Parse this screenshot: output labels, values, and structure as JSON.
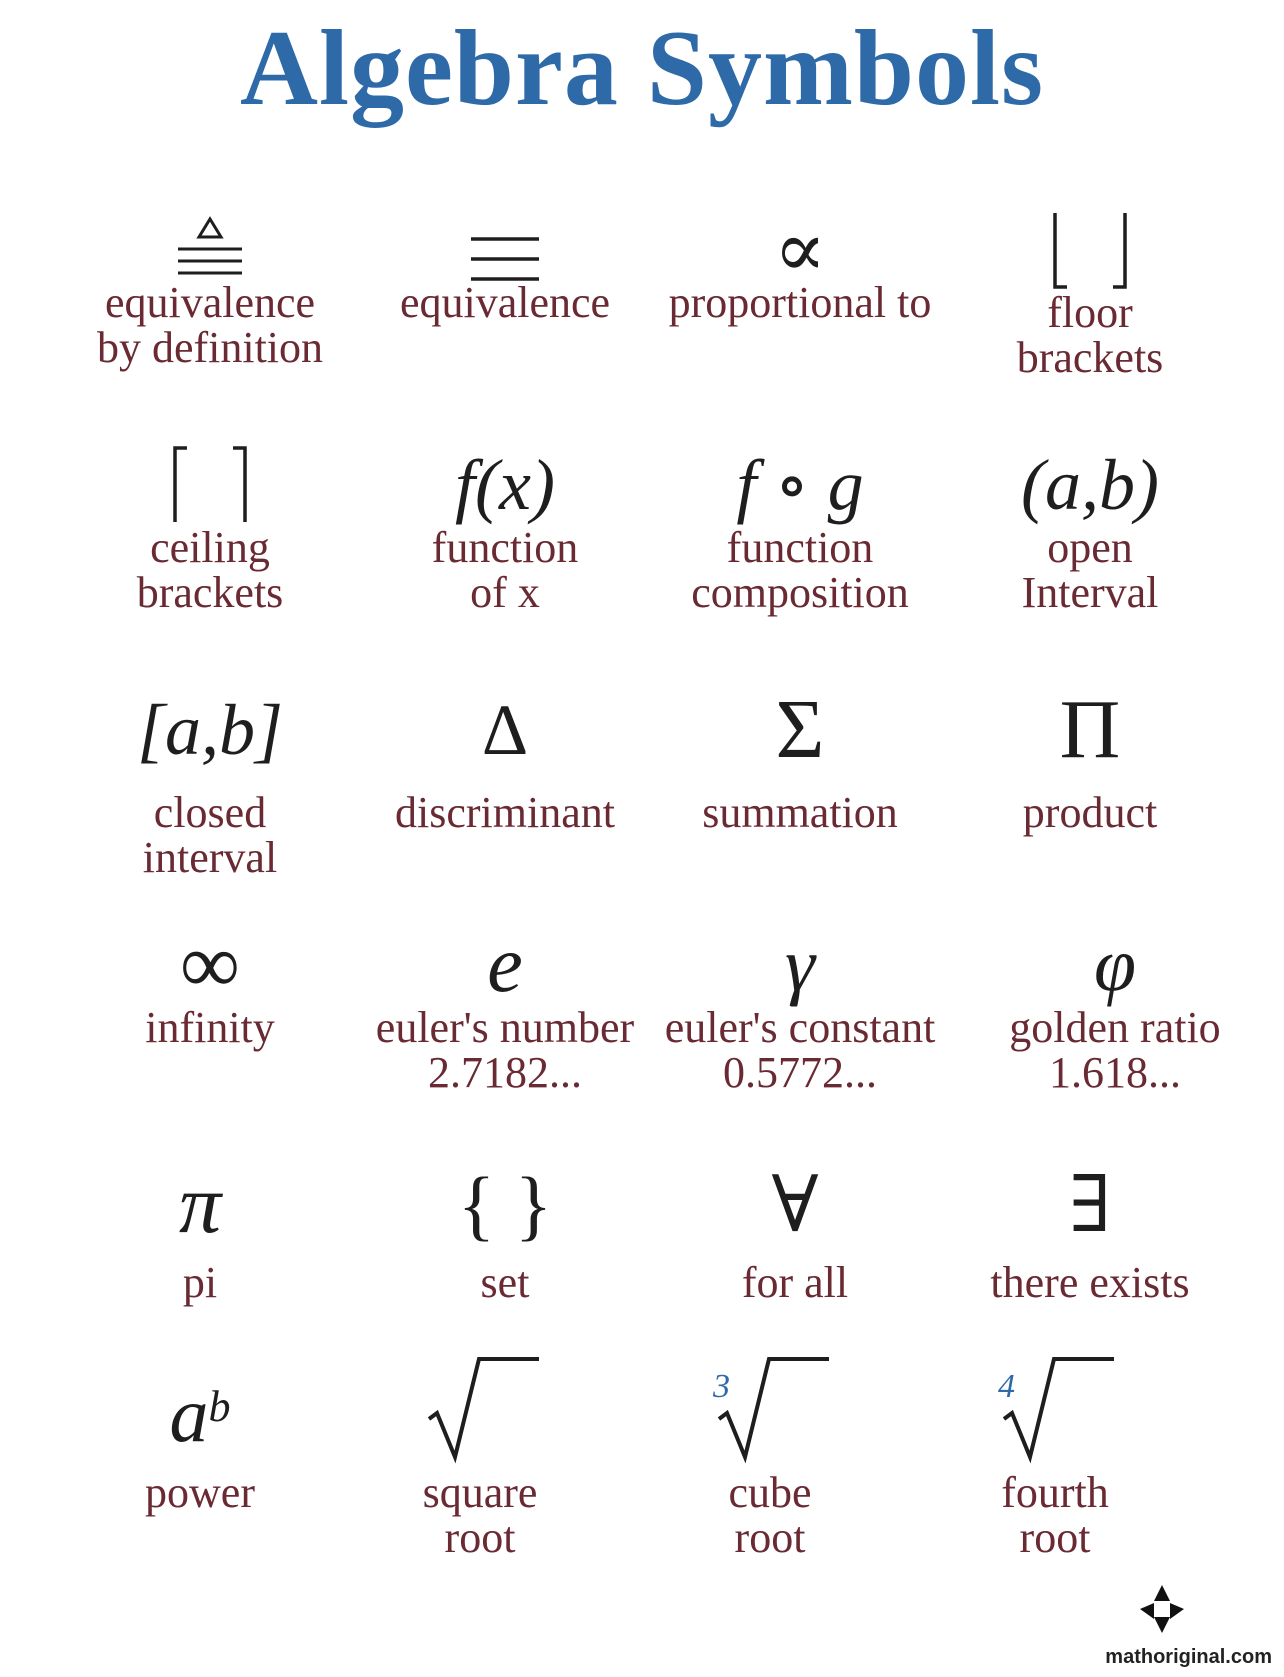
{
  "title": "Algebra Symbols",
  "symbols": [
    {
      "id": "equiv-def",
      "symbol": "≜",
      "icon": "equivalence-by-definition-icon",
      "label": [
        "equivalence",
        "by definition"
      ]
    },
    {
      "id": "equiv",
      "symbol": "≡",
      "icon": "equivalence-icon",
      "label": [
        "equivalence"
      ]
    },
    {
      "id": "prop",
      "symbol": "∝",
      "icon": "proportional-to-icon",
      "label": [
        "proportional to"
      ]
    },
    {
      "id": "floor",
      "symbol": "⌊ ⌋",
      "icon": "floor-brackets-icon",
      "label": [
        "floor",
        "brackets"
      ]
    },
    {
      "id": "ceil",
      "symbol": "⌈ ⌉",
      "icon": "ceiling-brackets-icon",
      "label": [
        "ceiling",
        "brackets"
      ]
    },
    {
      "id": "fx",
      "symbol": "f(x)",
      "icon": "function-of-x-icon",
      "label": [
        "function",
        "of x"
      ]
    },
    {
      "id": "fog",
      "symbol": "f ∘ g",
      "icon": "function-composition-icon",
      "label": [
        "function",
        "composition"
      ]
    },
    {
      "id": "open",
      "symbol": "(a,b)",
      "icon": "open-interval-icon",
      "label": [
        "open",
        "Interval"
      ]
    },
    {
      "id": "closed",
      "symbol": "[a,b]",
      "icon": "closed-interval-icon",
      "label": [
        "closed",
        "interval"
      ]
    },
    {
      "id": "disc",
      "symbol": "Δ",
      "icon": "discriminant-icon",
      "label": [
        "discriminant"
      ]
    },
    {
      "id": "sum",
      "symbol": "Σ",
      "icon": "summation-icon",
      "label": [
        "summation"
      ]
    },
    {
      "id": "prod",
      "symbol": "Π",
      "icon": "product-icon",
      "label": [
        "product"
      ]
    },
    {
      "id": "inf",
      "symbol": "∞",
      "icon": "infinity-icon",
      "label": [
        "infinity"
      ]
    },
    {
      "id": "e",
      "symbol": "e",
      "icon": "eulers-number-icon",
      "label": [
        "euler's number",
        "2.7182..."
      ]
    },
    {
      "id": "gamma",
      "symbol": "γ",
      "icon": "eulers-constant-icon",
      "label": [
        "euler's constant",
        "0.5772..."
      ]
    },
    {
      "id": "phi",
      "symbol": "φ",
      "icon": "golden-ratio-icon",
      "label": [
        "golden ratio",
        "1.618..."
      ]
    },
    {
      "id": "pi",
      "symbol": "π",
      "icon": "pi-icon",
      "label": [
        "pi"
      ]
    },
    {
      "id": "set",
      "symbol": "{ }",
      "icon": "set-icon",
      "label": [
        "set"
      ]
    },
    {
      "id": "forall",
      "symbol": "∀",
      "icon": "for-all-icon",
      "label": [
        "for all"
      ]
    },
    {
      "id": "exists",
      "symbol": "∃",
      "icon": "there-exists-icon",
      "label": [
        "there exists"
      ]
    },
    {
      "id": "power",
      "symbol": "a",
      "superscript": "b",
      "icon": "power-icon",
      "label": [
        "power"
      ]
    },
    {
      "id": "sqrt",
      "symbol": "√",
      "icon": "square-root-icon",
      "label": [
        "square",
        "root"
      ]
    },
    {
      "id": "cbrt",
      "symbol": "√",
      "index": "3",
      "icon": "cube-root-icon",
      "label": [
        "cube",
        "root"
      ]
    },
    {
      "id": "qrt",
      "symbol": "√",
      "index": "4",
      "icon": "fourth-root-icon",
      "label": [
        "fourth",
        "root"
      ]
    }
  ],
  "footer": {
    "site": "mathoriginal.com",
    "logo_icon": "mathoriginal-logo-icon"
  },
  "colors": {
    "title": "#2f6aa8",
    "label": "#6a2a33",
    "symbol": "#1e1e1e",
    "index": "#2f6aa8"
  }
}
